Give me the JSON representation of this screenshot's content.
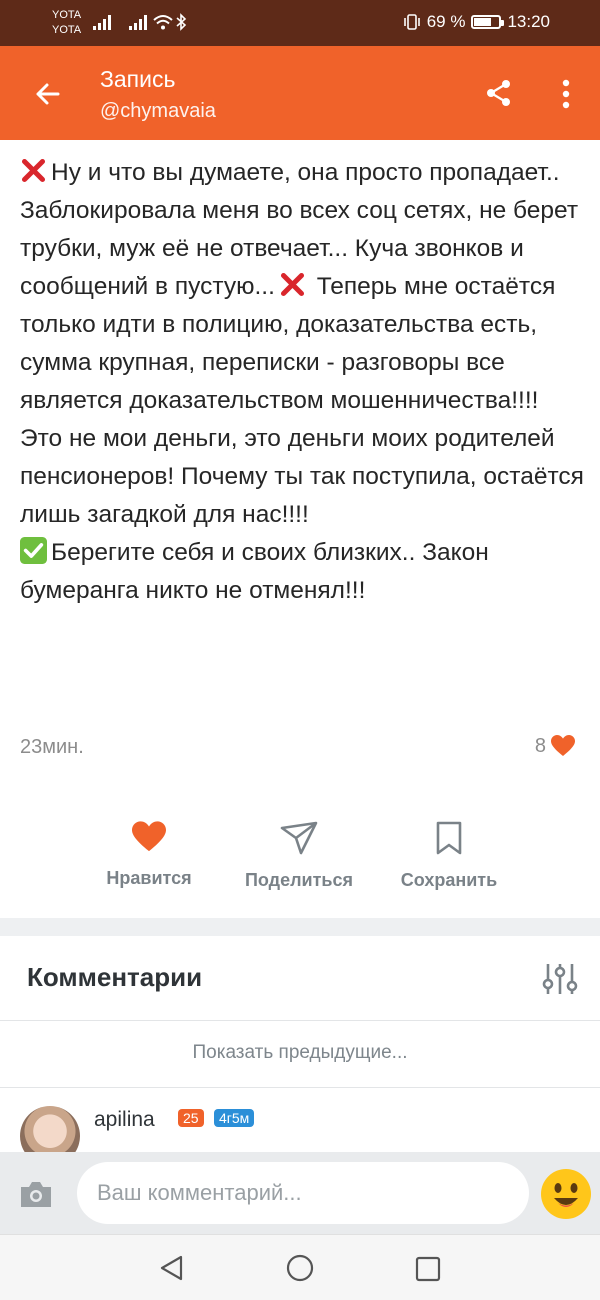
{
  "status_bar": {
    "carrier_1": "YOTA",
    "carrier_2": "YOTA",
    "battery_text": "69 %",
    "battery_level": 0.69,
    "time": "13:20"
  },
  "app_bar": {
    "title": "Запись",
    "subtitle": "@chymavaia",
    "accent_color": "#f0622a"
  },
  "post": {
    "paragraphs": [
      {
        "prefix_icon": "cross-mark-icon",
        "before": "Ну и что вы думаете, она просто пропадает.. Заблокировала меня во всех соц сетях, не берет трубки, муж её не отвечает... Куча звонков и сообщений в пустую...",
        "inline_icon": "cross-mark-icon",
        "after": " Теперь мне остаётся только идти в полицию, доказательства есть, сумма крупная, переписки - разговоры все является доказательством мошенничества!!!!"
      },
      {
        "text": "Это не мои деньги, это деньги моих родителей пенсионеров! Почему ты так поступила, остаётся лишь загадкой для нас!!!!"
      },
      {
        "prefix_icon": "check-mark-icon",
        "text": "Берегите себя и своих близких.. Закон бумеранга никто не отменял!!!"
      }
    ],
    "time": "23мин.",
    "likes": "8"
  },
  "actions": {
    "like_label": "Нравится",
    "share_label": "Поделиться",
    "save_label": "Сохранить"
  },
  "comments": {
    "title": "Комментарии",
    "show_previous": "Показать предыдущие...",
    "items": [
      {
        "author": "apilina",
        "badge_level": "25",
        "badge_duration": "4г5м"
      }
    ]
  },
  "composer": {
    "placeholder": "Ваш комментарий..."
  }
}
